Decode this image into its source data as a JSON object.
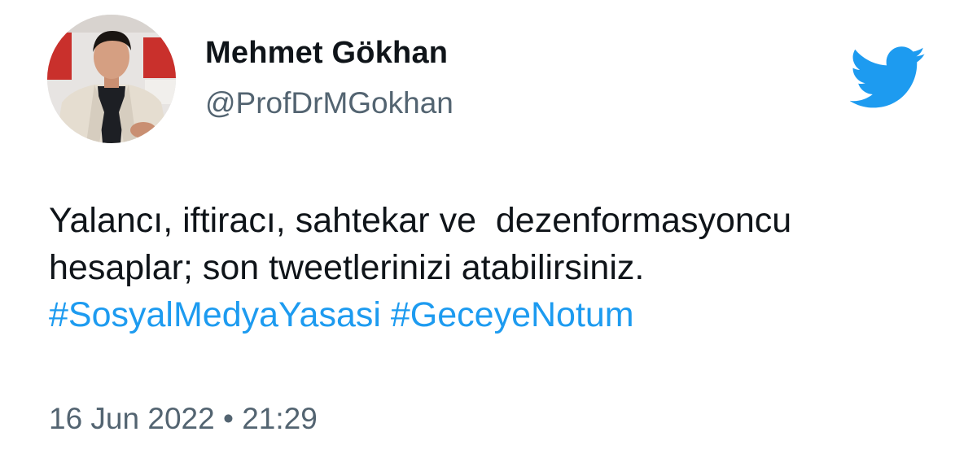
{
  "user": {
    "display_name": "Mehmet Gökhan",
    "handle": "@ProfDrMGokhan"
  },
  "tweet": {
    "text_line_1": "Yalancı, iftiracı, sahtekar ve  dezenformasyoncu",
    "text_line_2": "hesaplar; son tweetlerinizi atabilirsiniz.",
    "hashtags": [
      "#SosyalMedyaYasasi",
      "#GeceyeNotum"
    ],
    "timestamp": "16 Jun 2022 • 21:29"
  },
  "icons": {
    "logo": "twitter-bird-icon"
  },
  "colors": {
    "brand": "#1d9bf0",
    "text": "#0f1419",
    "secondary_text": "#536471"
  }
}
